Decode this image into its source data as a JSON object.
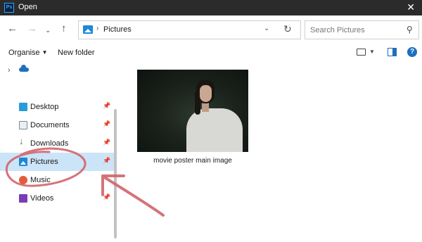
{
  "window": {
    "title": "Open",
    "app_badge": "Ps"
  },
  "navigation": {
    "address": "Pictures",
    "search_placeholder": "Search Pictures"
  },
  "toolbar": {
    "organise_label": "Organise",
    "new_folder_label": "New folder"
  },
  "sidebar": {
    "items": [
      {
        "label": "Desktop",
        "icon": "desktop-icon",
        "pinned": true
      },
      {
        "label": "Documents",
        "icon": "documents-icon",
        "pinned": true
      },
      {
        "label": "Downloads",
        "icon": "download-arrow-icon",
        "pinned": true
      },
      {
        "label": "Pictures",
        "icon": "pictures-icon",
        "pinned": true,
        "selected": true
      },
      {
        "label": "Music",
        "icon": "music-icon",
        "pinned": false
      },
      {
        "label": "Videos",
        "icon": "videos-icon",
        "pinned": true
      }
    ]
  },
  "files": [
    {
      "name": "movie poster main image",
      "type": "image"
    }
  ],
  "colors": {
    "titlebar": "#2b2b2b",
    "selection": "#cce4f7",
    "accent": "#1e6fbf",
    "annotation": "#d0646b"
  }
}
